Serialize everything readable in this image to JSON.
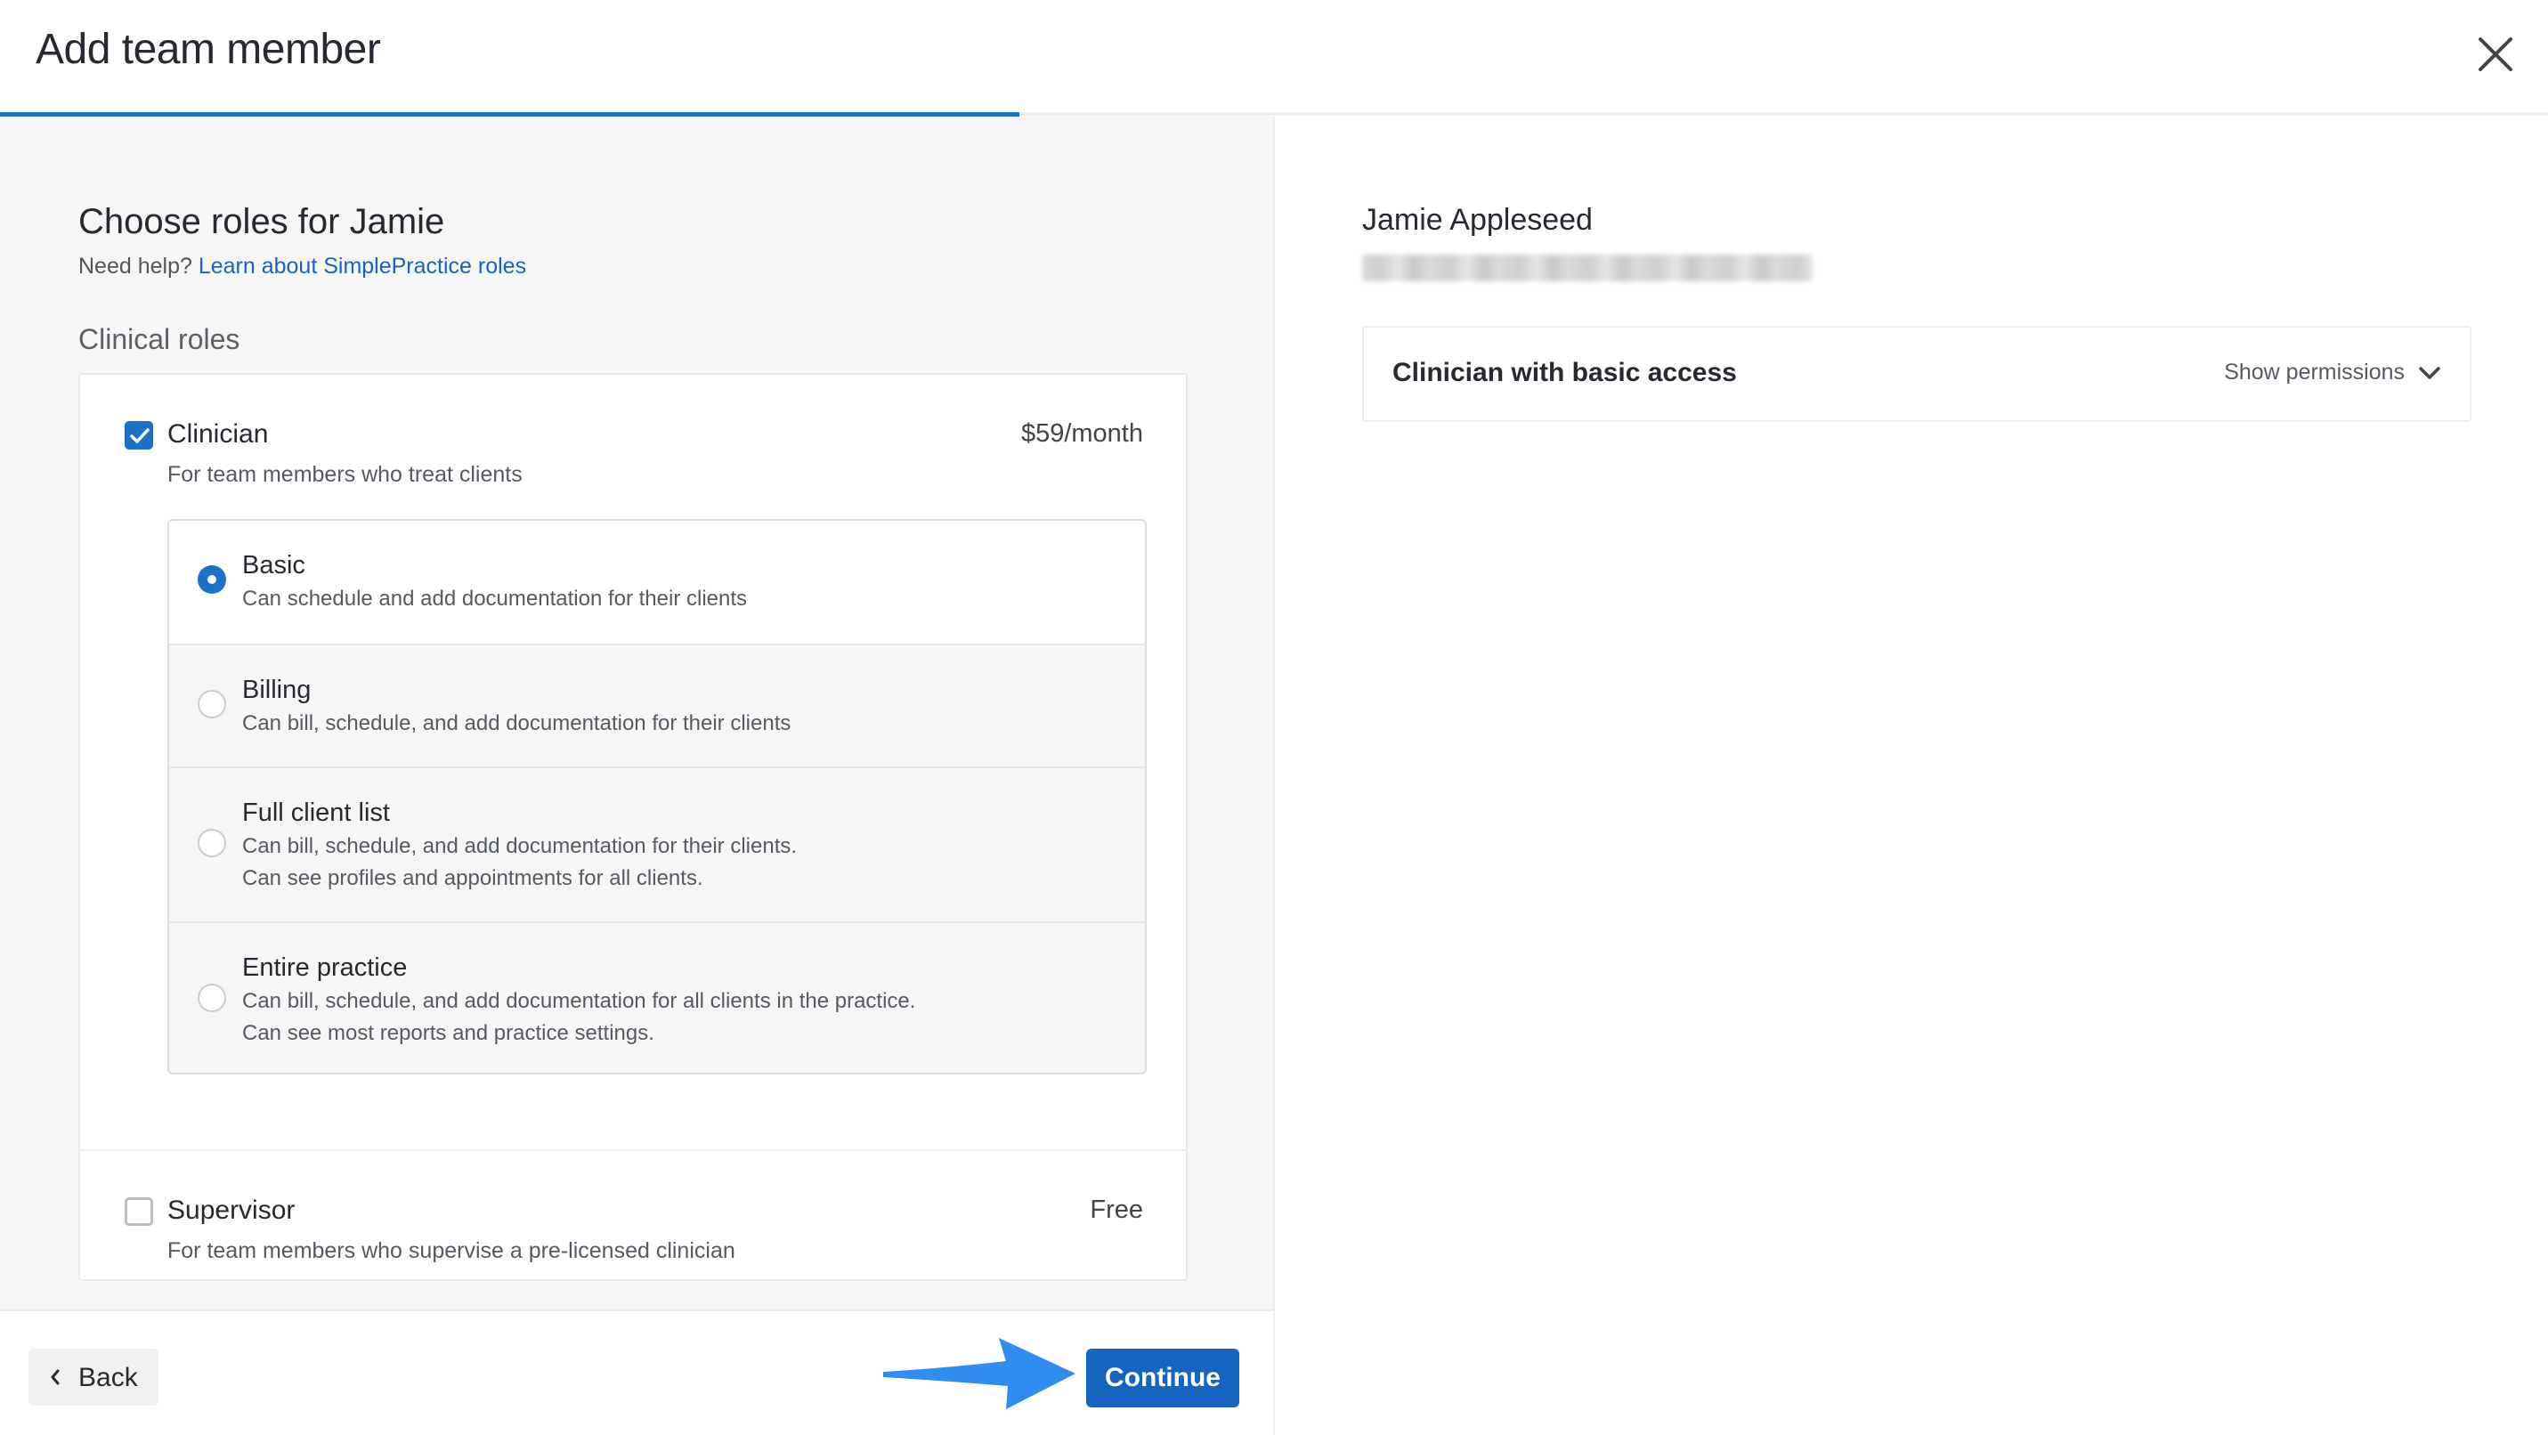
{
  "header": {
    "title": "Add team member",
    "progress": 0.4
  },
  "left": {
    "heading": "Choose roles for Jamie",
    "help_prefix": "Need help? ",
    "help_link": "Learn about SimplePractice roles",
    "section_label": "Clinical roles",
    "roles": [
      {
        "name": "Clinician",
        "description": "For team members who treat clients",
        "price": "$59/month",
        "checked": true,
        "options": [
          {
            "name": "Basic",
            "desc1": "Can schedule and add documentation for their clients",
            "selected": true
          },
          {
            "name": "Billing",
            "desc1": "Can bill, schedule, and add documentation for their clients",
            "selected": false
          },
          {
            "name": "Full client list",
            "desc1": "Can bill, schedule, and add documentation for their clients.",
            "desc2": "Can see profiles and appointments for all clients.",
            "selected": false
          },
          {
            "name": "Entire practice",
            "desc1": "Can bill, schedule, and add documentation for all clients in the practice.",
            "desc2": "Can see most reports and practice settings.",
            "selected": false
          }
        ]
      },
      {
        "name": "Supervisor",
        "description": "For team members who supervise a pre-licensed clinician",
        "price": "Free",
        "checked": false
      }
    ]
  },
  "footer": {
    "back_label": "Back",
    "continue_label": "Continue"
  },
  "right": {
    "name": "Jamie Appleseed",
    "summary_title": "Clinician with basic access",
    "show_permissions": "Show permissions"
  },
  "colors": {
    "accent": "#1a73c9",
    "primary_button": "#1565c0",
    "annotation_arrow": "#2f8df2"
  },
  "icons": {
    "close": "close-icon",
    "check": "checkmark-icon",
    "chevron_down": "chevron-down-icon",
    "chevron_left": "chevron-left-icon"
  }
}
